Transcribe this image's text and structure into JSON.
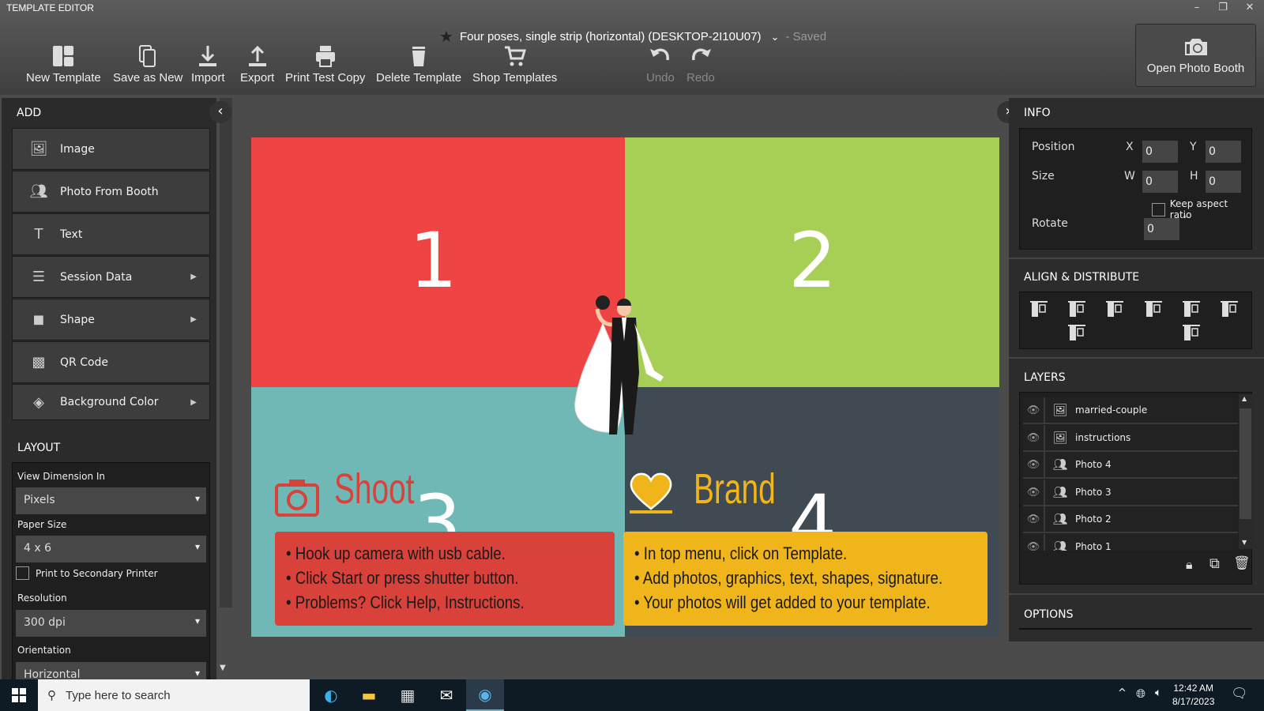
{
  "app": {
    "title": "TEMPLATE EDITOR"
  },
  "document": {
    "name": "Four poses, single strip (horizontal) (DESKTOP-2I10U07)",
    "status": "- Saved"
  },
  "toolbar": {
    "new_template": "New Template",
    "save_as_new": "Save as New",
    "import": "Import",
    "export": "Export",
    "print_test_copy": "Print Test Copy",
    "delete_template": "Delete Template",
    "shop_templates": "Shop Templates",
    "undo": "Undo",
    "redo": "Redo",
    "open_photo_booth": "Open Photo Booth"
  },
  "add": {
    "title": "ADD",
    "items": [
      {
        "label": "Image",
        "icon": "image-icon"
      },
      {
        "label": "Photo From Booth",
        "icon": "photo-booth-icon"
      },
      {
        "label": "Text",
        "icon": "text-icon"
      },
      {
        "label": "Session Data",
        "icon": "session-data-icon",
        "submenu": true
      },
      {
        "label": "Shape",
        "icon": "shape-icon",
        "submenu": true
      },
      {
        "label": "QR Code",
        "icon": "qr-code-icon"
      },
      {
        "label": "Background Color",
        "icon": "paint-bucket-icon",
        "submenu": true
      }
    ]
  },
  "layout": {
    "title": "LAYOUT",
    "view_dimension_label": "View Dimension In",
    "view_dimension": "Pixels",
    "paper_size_label": "Paper Size",
    "paper_size": "4 x 6",
    "secondary_printer_label": "Print to Secondary Printer",
    "secondary_printer": false,
    "resolution_label": "Resolution",
    "resolution": "300 dpi",
    "orientation_label": "Orientation",
    "orientation": "Horizontal"
  },
  "canvas": {
    "colors": {
      "q1": "#ef4444",
      "q2": "#a8cf55",
      "q3": "#6fb8b6",
      "q4": "#3f4a52",
      "shoot_box": "#d9423a",
      "brand_box": "#f1b51c",
      "shoot_text": "#d9423a",
      "brand_text": "#f1b51c"
    },
    "numbers": [
      "1",
      "2",
      "3",
      "4"
    ],
    "shoot": {
      "heading": "Shoot",
      "lines": [
        "• Hook up camera with usb cable.",
        "• Click Start or press shutter button.",
        "• Problems? Click Help, Instructions."
      ]
    },
    "brand": {
      "heading": "Brand",
      "lines": [
        "• In top menu, click on Template.",
        "• Add photos, graphics, text, shapes, signature.",
        "• Your photos will get added to your template."
      ]
    }
  },
  "info": {
    "title": "INFO",
    "position_label": "Position",
    "x_label": "X",
    "x": "0",
    "y_label": "Y",
    "y": "0",
    "size_label": "Size",
    "w_label": "W",
    "w": "0",
    "h_label": "H",
    "h": "0",
    "keep_aspect_label": "Keep aspect ratio",
    "keep_aspect": false,
    "rotate_label": "Rotate",
    "rotate": "0",
    "degree": "°"
  },
  "align": {
    "title": "ALIGN & DISTRIBUTE"
  },
  "layers": {
    "title": "LAYERS",
    "items": [
      {
        "name": "married-couple",
        "type": "image"
      },
      {
        "name": "instructions",
        "type": "image"
      },
      {
        "name": "Photo 4",
        "type": "photo"
      },
      {
        "name": "Photo 3",
        "type": "photo"
      },
      {
        "name": "Photo 2",
        "type": "photo"
      },
      {
        "name": "Photo 1",
        "type": "photo"
      }
    ]
  },
  "options": {
    "title": "OPTIONS"
  },
  "taskbar": {
    "search_placeholder": "Type here to search",
    "time": "12:42 AM",
    "date": "8/17/2023"
  }
}
